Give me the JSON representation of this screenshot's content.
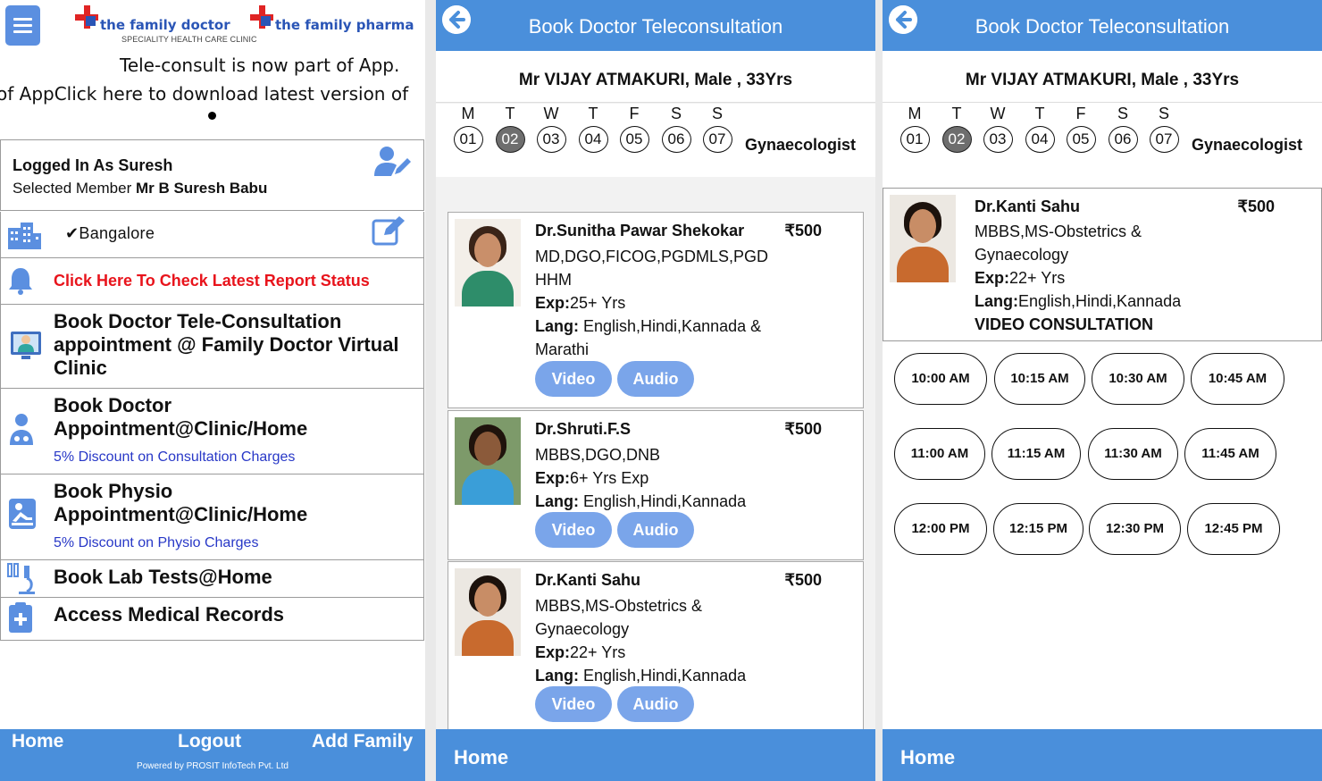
{
  "home": {
    "logo1": {
      "name": "the family doctor",
      "tagline": "SPECIALITY HEALTH CARE CLINIC"
    },
    "logo2": {
      "name": "the family pharma"
    },
    "marquee_line1": "Tele-consult is now part of App.",
    "marquee_line2": "of AppClick here to download latest version of",
    "login": {
      "prefix": "Logged In As Suresh",
      "member_label": "Selected Member",
      "member_name": "Mr B Suresh Babu"
    },
    "city": "✔Bangalore",
    "status_link": "Click Here To Check Latest Report Status",
    "menu": [
      {
        "label": "Book Doctor Tele-Consultation appointment @ Family Doctor Virtual Clinic"
      },
      {
        "label": "Book Doctor Appointment@Clinic/Home",
        "sub": "5% Discount on Consultation Charges"
      },
      {
        "label": "Book Physio Appointment@Clinic/Home",
        "sub": "5% Discount on Physio Charges"
      },
      {
        "label": "Book Lab Tests@Home"
      },
      {
        "label": "Access Medical Records"
      }
    ],
    "footer": {
      "home": "Home",
      "logout": "Logout",
      "add_family": "Add Family",
      "powered": "Powered by PROSIT InfoTech Pvt. Ltd"
    }
  },
  "booking": {
    "title": "Book Doctor Teleconsultation",
    "patient": "Mr VIJAY ATMAKURI, Male , 33Yrs",
    "week": [
      {
        "l": "M",
        "n": "01"
      },
      {
        "l": "T",
        "n": "02"
      },
      {
        "l": "W",
        "n": "03"
      },
      {
        "l": "T",
        "n": "04"
      },
      {
        "l": "F",
        "n": "05"
      },
      {
        "l": "S",
        "n": "06"
      },
      {
        "l": "S",
        "n": "07"
      }
    ],
    "selected_day": "02",
    "specialty": "Gynaecologist",
    "exp_label": "Exp:",
    "lang_label": "Lang:",
    "video_label": "Video",
    "audio_label": "Audio",
    "doctors": [
      {
        "name": "Dr.Sunitha Pawar Shekokar",
        "price": "₹500",
        "qual": "MD,DGO,FICOG,PGDMLS,PGD HHM",
        "exp": "25+ Yrs",
        "lang": " English,Hindi,Kannada & Marathi"
      },
      {
        "name": "Dr.Shruti.F.S",
        "price": "₹500",
        "qual": "MBBS,DGO,DNB",
        "exp": "6+ Yrs Exp",
        "lang": " English,Hindi,Kannada"
      },
      {
        "name": "Dr.Kanti Sahu",
        "price": "₹500",
        "qual": "MBBS,MS-Obstetrics & Gynaecology",
        "exp": "22+ Yrs",
        "lang": " English,Hindi,Kannada"
      }
    ],
    "footer_home": "Home"
  },
  "slots_screen": {
    "doctor": {
      "name": "Dr.Kanti Sahu",
      "price": "₹500",
      "qual": "MBBS,MS-Obstetrics & Gynaecology",
      "exp": "22+ Yrs",
      "lang": "English,Hindi,Kannada",
      "mode": "VIDEO CONSULTATION"
    },
    "slots": [
      "10:00 AM",
      "10:15 AM",
      "10:30 AM",
      "10:45 AM",
      "11:00 AM",
      "11:15 AM",
      "11:30 AM",
      "11:45 AM",
      "12:00 PM",
      "12:15 PM",
      "12:30 PM",
      "12:45 PM"
    ]
  },
  "colors": {
    "brand_blue": "#4a8fdb",
    "pill_blue": "#7aa5ea",
    "alert_red": "#e8141c",
    "discount_blue": "#2838c7"
  }
}
